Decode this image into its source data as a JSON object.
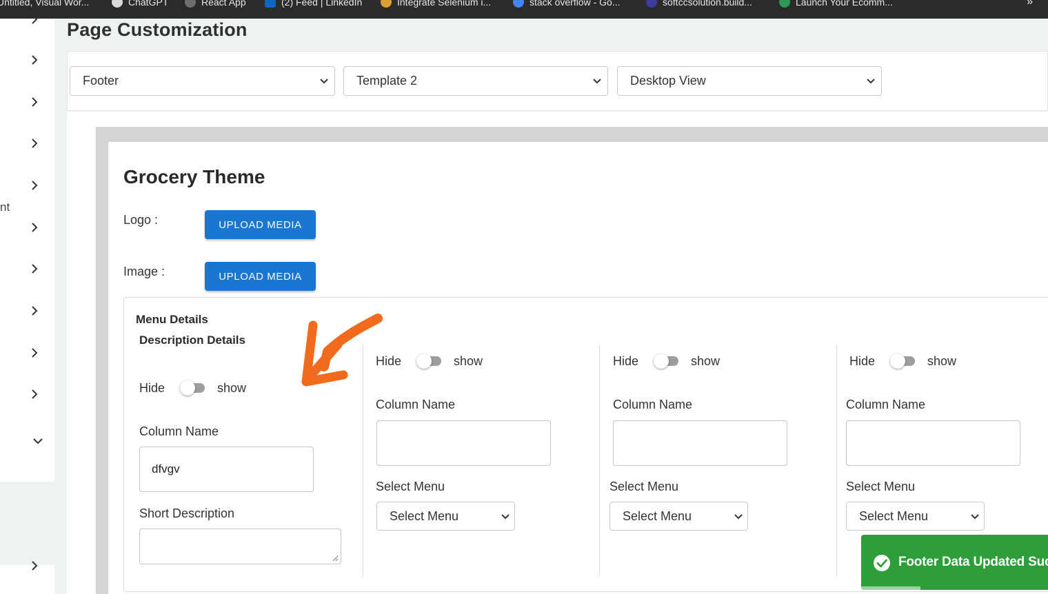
{
  "bookmarks": [
    {
      "label": "Untitled, Visual Wor...",
      "color": "#8a8a8a"
    },
    {
      "label": "ChatGPT",
      "color": "#d9d9d9"
    },
    {
      "label": "React App",
      "color": "#6d6d6d"
    },
    {
      "label": "(2) Feed | LinkedIn",
      "color": "#0a66c2"
    },
    {
      "label": "Integrate Selenium i...",
      "color": "#e0a030"
    },
    {
      "label": "stack overflow - Go...",
      "color": "#4285f4"
    },
    {
      "label": "softccsolution.build...",
      "color": "#3c3c9c"
    },
    {
      "label": "Launch Your Ecomm...",
      "color": "#2e9a5a"
    }
  ],
  "bookmarks_more": "»",
  "sidebar": {
    "partial_label": "nt"
  },
  "page": {
    "title": "Page Customization"
  },
  "filters": {
    "section": "Footer",
    "template": "Template 2",
    "view": "Desktop View"
  },
  "preview": {
    "theme_title": "Grocery Theme",
    "logo_label": "Logo :",
    "image_label": "Image :",
    "upload_label": "UPLOAD MEDIA",
    "menu_details": "Menu Details",
    "description_details": "Description Details",
    "hide_label": "Hide",
    "show_label": "show",
    "column_name_label": "Column Name",
    "short_description_label": "Short Description",
    "select_menu_label": "Select Menu",
    "select_menu_placeholder": "Select Menu",
    "description_column_value": "dfvgv"
  },
  "toast": {
    "message": "Footer Data Updated Succe",
    "color": "#2e9e3a"
  },
  "colors": {
    "primary_button": "#1976d2",
    "annotation_arrow": "#f26a1b"
  }
}
